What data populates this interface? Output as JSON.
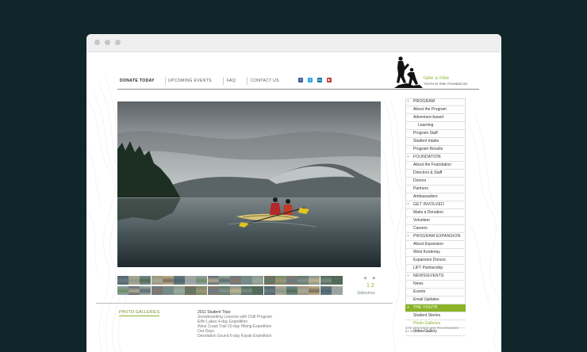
{
  "nav": {
    "items": [
      "DONATE TODAY",
      "UPCOMING EVENTS",
      "FAQ",
      "CONTACT US"
    ]
  },
  "social": [
    {
      "icon": "facebook-icon",
      "glyph": "f",
      "color": "#3b5998"
    },
    {
      "icon": "twitter-icon",
      "glyph": "t",
      "color": "#2aa9e0"
    },
    {
      "icon": "linkedin-icon",
      "glyph": "in",
      "color": "#0e76a8"
    },
    {
      "icon": "youtube-icon",
      "glyph": "▶",
      "color": "#c4302b"
    }
  ],
  "logo": {
    "title": "take a hike",
    "subtitle": "YOUTH AT RISK FOUNDATION"
  },
  "slideshow": {
    "pages": "1 2",
    "label": "Slideshow",
    "prev": "◀",
    "next": "▶"
  },
  "gallery_link": "PHOTO GALLERIES",
  "trips": {
    "title": "2011 Student Trips",
    "items": [
      "Snowboarding Lessons with Chill Program",
      "Elfin Lakes 4-day Expedition",
      "West Coast Trail 10-day Hiking Expedition",
      "Out Days",
      "Desolation Sound 6-day Kayak Expedition"
    ]
  },
  "sidebar": [
    {
      "label": "PROGRAM",
      "type": "head"
    },
    {
      "label": "About the Program",
      "type": "item"
    },
    {
      "label": "Adventure-based",
      "type": "item"
    },
    {
      "label": "Learning",
      "type": "indent"
    },
    {
      "label": "Program Staff",
      "type": "item"
    },
    {
      "label": "Student Intake",
      "type": "item"
    },
    {
      "label": "Program Results",
      "type": "item"
    },
    {
      "label": "FOUNDATION",
      "type": "head"
    },
    {
      "label": "About the Foundation",
      "type": "item"
    },
    {
      "label": "Directors & Staff",
      "type": "item"
    },
    {
      "label": "Donors",
      "type": "item"
    },
    {
      "label": "Partners",
      "type": "item"
    },
    {
      "label": "Ambassadors",
      "type": "item"
    },
    {
      "label": "GET INVOLVED",
      "type": "head"
    },
    {
      "label": "Make a Donation",
      "type": "item"
    },
    {
      "label": "Volunteer",
      "type": "item"
    },
    {
      "label": "Careers",
      "type": "item"
    },
    {
      "label": "PROGRAM EXPANSION",
      "type": "head"
    },
    {
      "label": "About Expansion",
      "type": "item"
    },
    {
      "label": "West Kootenay",
      "type": "item"
    },
    {
      "label": "Expansion Donors",
      "type": "item"
    },
    {
      "label": "LIFT Partnership",
      "type": "item"
    },
    {
      "label": "NEWS/EVENTS",
      "type": "head"
    },
    {
      "label": "News",
      "type": "item"
    },
    {
      "label": "Events",
      "type": "item"
    },
    {
      "label": "Email Updates",
      "type": "item"
    },
    {
      "label": "THE YOUTH",
      "type": "active"
    },
    {
      "label": "Student Stories",
      "type": "item"
    },
    {
      "label": "Photo Galleries",
      "type": "cur"
    },
    {
      "label": "Video Gallery",
      "type": "item"
    }
  ],
  "credit": {
    "line1": "SITE DESIGNED AND PROGRAMMED",
    "line2": "BY MULTIPLE INC."
  },
  "colors": {
    "accent": "#8bb42a",
    "background": "#10262a"
  }
}
